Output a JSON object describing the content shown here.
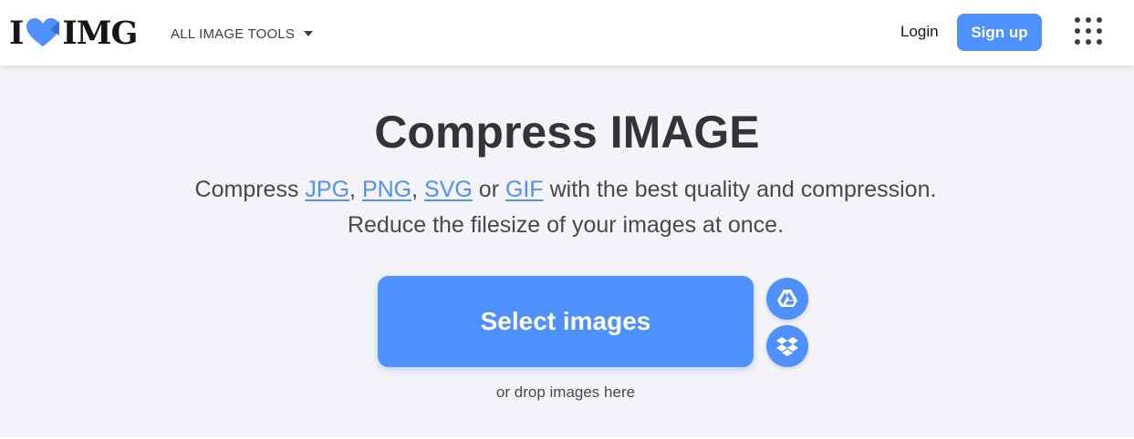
{
  "header": {
    "logo": {
      "left_text": "I",
      "right_text": "IMG",
      "heart_icon": "heart-icon"
    },
    "tools_menu_label": "ALL IMAGE TOOLS",
    "login_label": "Login",
    "signup_label": "Sign up",
    "apps_icon": "apps-grid-icon"
  },
  "main": {
    "title": "Compress IMAGE",
    "subtitle": {
      "prefix": "Compress ",
      "formats": [
        "JPG",
        "PNG",
        "SVG",
        "GIF"
      ],
      "sep1": ", ",
      "sep2": ", ",
      "sep3": " or ",
      "suffix": " with the best quality and compression.",
      "line2": "Reduce the filesize of your images at once."
    },
    "select_button_label": "Select images",
    "cloud_buttons": [
      {
        "icon": "google-drive-icon"
      },
      {
        "icon": "dropbox-icon"
      }
    ],
    "drop_hint": "or drop images here"
  },
  "colors": {
    "accent": "#4d90fe",
    "background": "#f4f4f8",
    "header_bg": "#ffffff",
    "text_dark": "#33333b"
  }
}
